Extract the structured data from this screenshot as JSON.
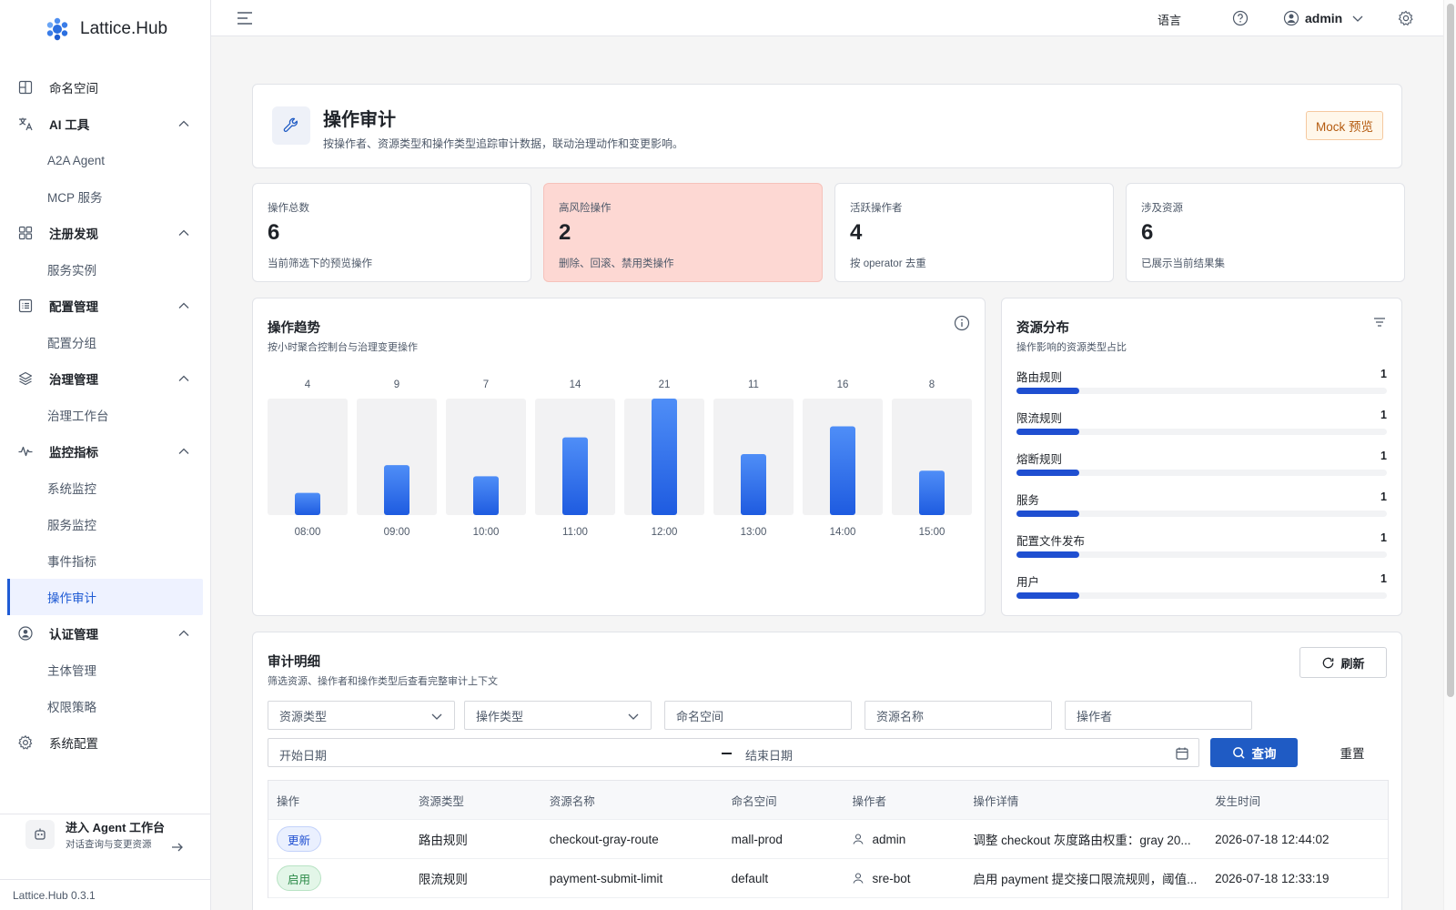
{
  "brand": {
    "name": "Lattice.Hub"
  },
  "sidebar": {
    "items": [
      {
        "label": "命名空间",
        "type": "item",
        "icon": "namespace-icon"
      },
      {
        "label": "AI 工具",
        "type": "group",
        "icon": "translate-icon"
      },
      {
        "label": "A2A Agent",
        "type": "sub"
      },
      {
        "label": "MCP 服务",
        "type": "sub"
      },
      {
        "label": "注册发现",
        "type": "group",
        "icon": "grid-icon"
      },
      {
        "label": "服务实例",
        "type": "sub"
      },
      {
        "label": "配置管理",
        "type": "group",
        "icon": "list-icon"
      },
      {
        "label": "配置分组",
        "type": "sub"
      },
      {
        "label": "治理管理",
        "type": "group",
        "icon": "layers-icon"
      },
      {
        "label": "治理工作台",
        "type": "sub"
      },
      {
        "label": "监控指标",
        "type": "group",
        "icon": "pulse-icon"
      },
      {
        "label": "系统监控",
        "type": "sub"
      },
      {
        "label": "服务监控",
        "type": "sub"
      },
      {
        "label": "事件指标",
        "type": "sub"
      },
      {
        "label": "操作审计",
        "type": "sub",
        "active": true
      },
      {
        "label": "认证管理",
        "type": "group",
        "icon": "user-circle-icon"
      },
      {
        "label": "主体管理",
        "type": "sub"
      },
      {
        "label": "权限策略",
        "type": "sub"
      },
      {
        "label": "系统配置",
        "type": "item",
        "icon": "gear-icon"
      }
    ],
    "agent": {
      "title": "进入 Agent 工作台",
      "subtitle": "对话查询与变更资源"
    },
    "version": "Lattice.Hub 0.3.1"
  },
  "topbar": {
    "language": "语言",
    "user": "admin"
  },
  "header": {
    "title": "操作审计",
    "description": "按操作者、资源类型和操作类型追踪审计数据，联动治理动作和变更影响。",
    "badge": "Mock 预览"
  },
  "stats": [
    {
      "label": "操作总数",
      "value": "6",
      "sub": "当前筛选下的预览操作",
      "risk": false
    },
    {
      "label": "高风险操作",
      "value": "2",
      "sub": "删除、回滚、禁用类操作",
      "risk": true
    },
    {
      "label": "活跃操作者",
      "value": "4",
      "sub": "按 operator 去重",
      "risk": false
    },
    {
      "label": "涉及资源",
      "value": "6",
      "sub": "已展示当前结果集",
      "risk": false
    }
  ],
  "trend": {
    "title": "操作趋势",
    "subtitle": "按小时聚合控制台与治理变更操作"
  },
  "distribution": {
    "title": "资源分布",
    "subtitle": "操作影响的资源类型占比",
    "items": [
      {
        "name": "路由规则",
        "value": "1",
        "fraction": 0.17
      },
      {
        "name": "限流规则",
        "value": "1",
        "fraction": 0.17
      },
      {
        "name": "熔断规则",
        "value": "1",
        "fraction": 0.17
      },
      {
        "name": "服务",
        "value": "1",
        "fraction": 0.17
      },
      {
        "name": "配置文件发布",
        "value": "1",
        "fraction": 0.17
      },
      {
        "name": "用户",
        "value": "1",
        "fraction": 0.17
      }
    ]
  },
  "detail": {
    "title": "审计明细",
    "subtitle": "筛选资源、操作者和操作类型后查看完整审计上下文",
    "refresh": "刷新",
    "filters": {
      "resource_type": "资源类型",
      "operation_type": "操作类型",
      "namespace": "命名空间",
      "resource_name": "资源名称",
      "operator": "操作者",
      "start_date": "开始日期",
      "end_date": "结束日期"
    },
    "query": "查询",
    "reset": "重置",
    "columns": [
      "操作",
      "资源类型",
      "资源名称",
      "命名空间",
      "操作者",
      "操作详情",
      "发生时间"
    ],
    "rows": [
      {
        "op": "更新",
        "op_kind": "update",
        "resource_type": "路由规则",
        "resource_name": "checkout-gray-route",
        "namespace": "mall-prod",
        "operator": "admin",
        "detail": "调整 checkout 灰度路由权重：gray 20...",
        "time": "2026-07-18 12:44:02"
      },
      {
        "op": "启用",
        "op_kind": "enable",
        "resource_type": "限流规则",
        "resource_name": "payment-submit-limit",
        "namespace": "default",
        "operator": "sre-bot",
        "detail": "启用 payment 提交接口限流规则，阈值...",
        "time": "2026-07-18 12:33:19"
      }
    ]
  },
  "chart_data": {
    "type": "bar",
    "categories": [
      "08:00",
      "09:00",
      "10:00",
      "11:00",
      "12:00",
      "13:00",
      "14:00",
      "15:00"
    ],
    "values": [
      4,
      9,
      7,
      14,
      21,
      11,
      16,
      8
    ],
    "title": "操作趋势",
    "ylim": [
      0,
      21
    ],
    "grid": false,
    "colors": {
      "bar_top": "#4f8ef7",
      "bar_bottom": "#1e5be0",
      "track": "#f2f2f3"
    }
  }
}
